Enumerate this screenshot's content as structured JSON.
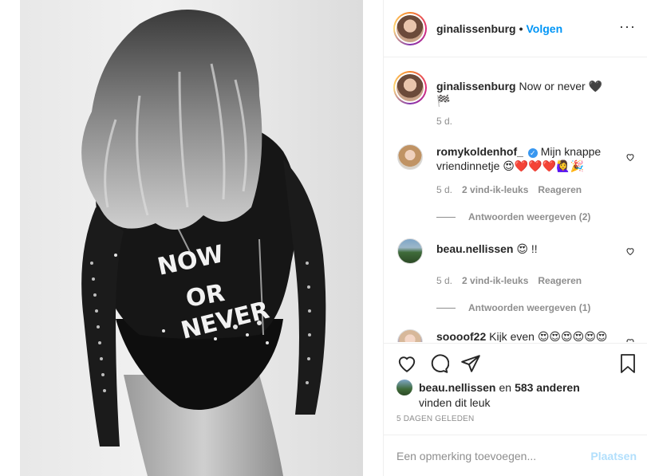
{
  "post": {
    "author": "ginalissenburg",
    "follow_label": "Volgen",
    "more_icon": "more-options-icon",
    "caption_user": "ginalissenburg",
    "caption_text": "Now or never 🖤🏁",
    "caption_age": "5 d."
  },
  "comments": [
    {
      "user": "romykoldenhof_",
      "verified": true,
      "text": "Mijn knappe vriendinnetje 😍❤️❤️❤️🙋‍♀️🎉",
      "age": "5 d.",
      "likes": "2 vind-ik-leuks",
      "reply_label": "Reageren",
      "view_replies": "Antwoorden weergeven (2)"
    },
    {
      "user": "beau.nellissen",
      "text": "😍 !!",
      "age": "5 d.",
      "likes": "2 vind-ik-leuks",
      "reply_label": "Reageren",
      "view_replies": "Antwoorden weergeven (1)"
    },
    {
      "user": "soooof22",
      "text": "Kijk even 😍😍😍😍😍😍😍😍"
    }
  ],
  "likes": {
    "first_user": "beau.nellissen",
    "and_word": "en",
    "others": "583 anderen",
    "suffix": "vinden dit leuk"
  },
  "time_ago": "5 DAGEN GELEDEN",
  "add_comment": {
    "placeholder": "Een opmerking toevoegen...",
    "post_label": "Plaatsen"
  },
  "photo": {
    "jacket_text_1": "NOW",
    "jacket_text_2": "OR",
    "jacket_text_3": "NEVER"
  },
  "colors": {
    "link_blue": "#0095f6",
    "muted": "#8e8e8e",
    "post_disabled": "#b2dffc"
  }
}
